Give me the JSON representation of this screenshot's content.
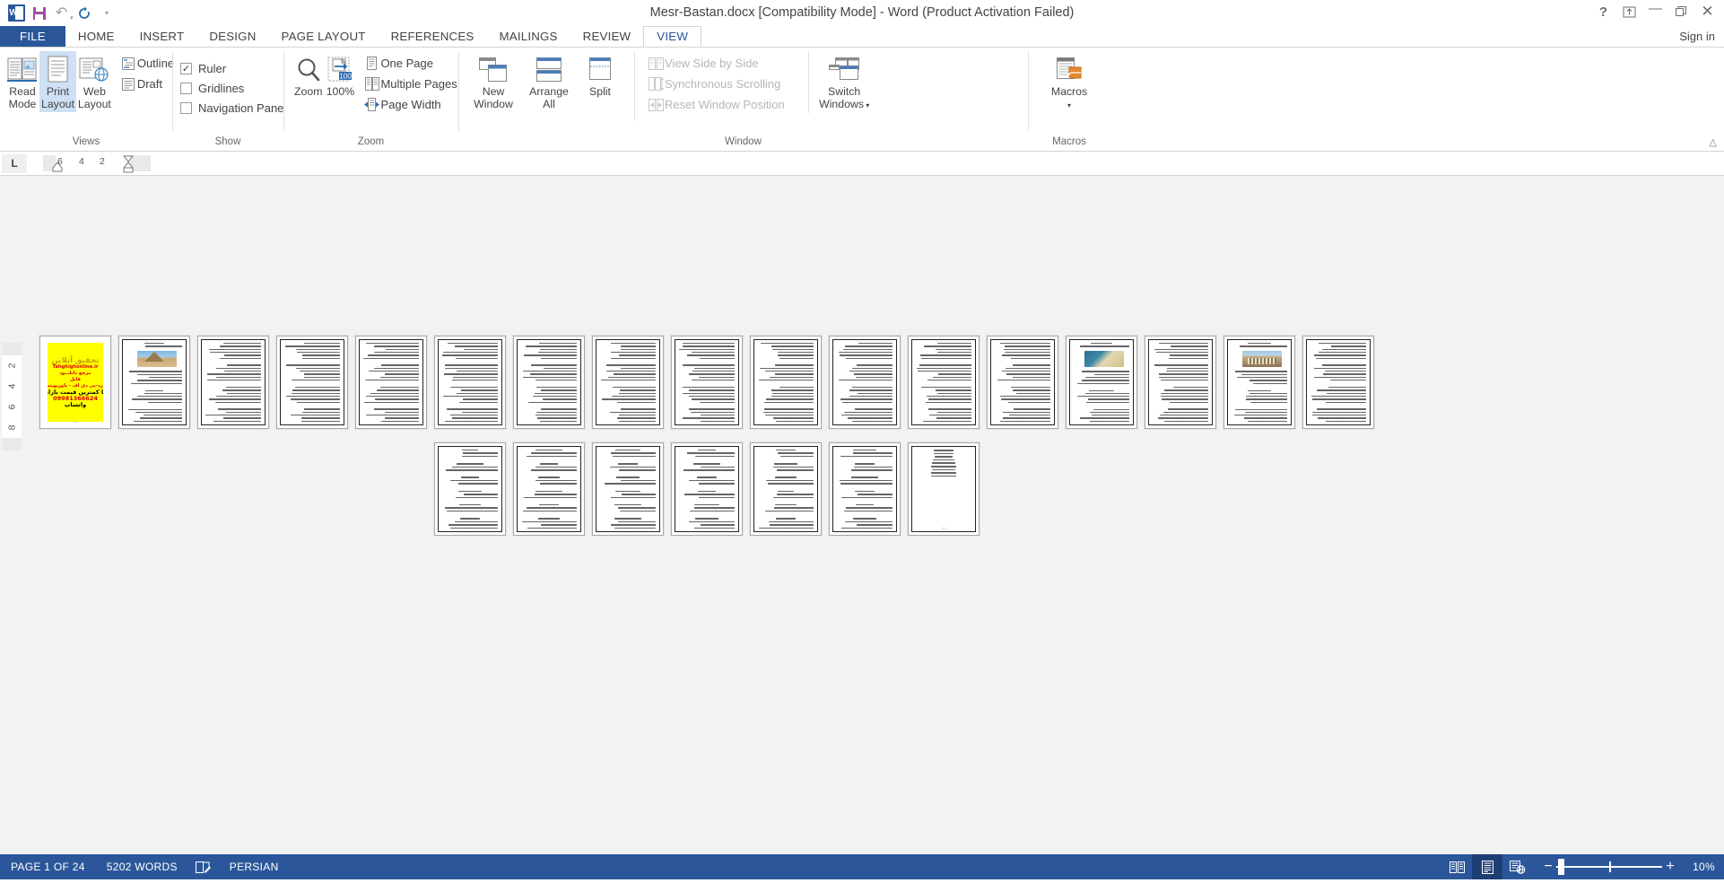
{
  "titlebar": {
    "document_title": "Mesr-Bastan.docx [Compatibility Mode] - Word (Product Activation Failed)",
    "quick_access": [
      {
        "name": "word-app-icon",
        "label": "W"
      },
      {
        "name": "save-icon",
        "label": ""
      },
      {
        "name": "undo-icon",
        "label": "↶"
      },
      {
        "name": "redo-icon",
        "label": "↻"
      },
      {
        "name": "customize-qat-icon",
        "label": "▾"
      }
    ],
    "window_controls": {
      "help": "?",
      "ribbon_display_options": "",
      "minimize": "—",
      "restore": "❐",
      "close": "✕"
    }
  },
  "tabs": [
    {
      "label": "FILE",
      "kind": "file"
    },
    {
      "label": "HOME",
      "kind": "normal"
    },
    {
      "label": "INSERT",
      "kind": "normal"
    },
    {
      "label": "DESIGN",
      "kind": "normal"
    },
    {
      "label": "PAGE LAYOUT",
      "kind": "normal"
    },
    {
      "label": "REFERENCES",
      "kind": "normal"
    },
    {
      "label": "MAILINGS",
      "kind": "normal"
    },
    {
      "label": "REVIEW",
      "kind": "normal"
    },
    {
      "label": "VIEW",
      "kind": "active"
    }
  ],
  "signin": "Sign in",
  "ribbon": {
    "collapse_arrow": "∧",
    "groups": {
      "views": {
        "label": "Views",
        "buttons": [
          {
            "name": "read-mode-button",
            "line1": "Read",
            "line2": "Mode",
            "selected": false
          },
          {
            "name": "print-layout-button",
            "line1": "Print",
            "line2": "Layout",
            "selected": true
          },
          {
            "name": "web-layout-button",
            "line1": "Web",
            "line2": "Layout",
            "selected": false
          }
        ],
        "small": [
          {
            "name": "outline-button",
            "label": "Outline"
          },
          {
            "name": "draft-button",
            "label": "Draft"
          }
        ]
      },
      "show": {
        "label": "Show",
        "checkboxes": [
          {
            "name": "ruler-checkbox",
            "label": "Ruler",
            "checked": true
          },
          {
            "name": "gridlines-checkbox",
            "label": "Gridlines",
            "checked": false
          },
          {
            "name": "navigation-pane-checkbox",
            "label": "Navigation Pane",
            "checked": false
          }
        ]
      },
      "zoom": {
        "label": "Zoom",
        "buttons": [
          {
            "name": "zoom-button",
            "label": "Zoom"
          },
          {
            "name": "zoom-100-button",
            "label": "100%",
            "badge": "100"
          }
        ],
        "small": [
          {
            "name": "one-page-button",
            "label": "One Page"
          },
          {
            "name": "multiple-pages-button",
            "label": "Multiple Pages"
          },
          {
            "name": "page-width-button",
            "label": "Page Width"
          }
        ]
      },
      "window": {
        "label": "Window",
        "buttons": [
          {
            "name": "new-window-button",
            "line1": "New",
            "line2": "Window"
          },
          {
            "name": "arrange-all-button",
            "line1": "Arrange",
            "line2": "All"
          },
          {
            "name": "split-button",
            "line1": "Split",
            "line2": ""
          }
        ],
        "small": [
          {
            "name": "view-side-by-side-button",
            "label": "View Side by Side",
            "disabled": true
          },
          {
            "name": "synchronous-scrolling-button",
            "label": "Synchronous Scrolling",
            "disabled": true
          },
          {
            "name": "reset-window-position-button",
            "label": "Reset Window Position",
            "disabled": true
          }
        ],
        "switch_windows": {
          "name": "switch-windows-button",
          "line1": "Switch",
          "line2": "Windows"
        }
      },
      "macros": {
        "label": "Macros",
        "button": {
          "name": "macros-button",
          "line1": "Macros",
          "line2": ""
        }
      }
    }
  },
  "ruler": {
    "tab_stop_indicator": "L",
    "horizontal_numbers": [
      "6",
      "4",
      "2"
    ],
    "vertical_numbers": [
      "2",
      "4",
      "6",
      "8"
    ]
  },
  "document": {
    "zoom_percent": "10%",
    "ad_page": {
      "title": "تحقیق آنلاین",
      "site": "Tahghighonline.ir",
      "line1": "مرجع دانلـــود",
      "line2": "فایل",
      "line3": "ورد-پی دی اف - پاورپوینت",
      "line4": "با کمترین قیمت بازار",
      "phone": "09981366624",
      "whatsapp": "واتساپ"
    },
    "row1_pages": [
      {
        "n": 1,
        "kind": "ad"
      },
      {
        "n": 2,
        "kind": "image",
        "image": "img-pyramid"
      },
      {
        "n": 3,
        "kind": "text"
      },
      {
        "n": 4,
        "kind": "text"
      },
      {
        "n": 5,
        "kind": "text"
      },
      {
        "n": 6,
        "kind": "text"
      },
      {
        "n": 7,
        "kind": "text"
      },
      {
        "n": 8,
        "kind": "text"
      },
      {
        "n": 9,
        "kind": "text"
      },
      {
        "n": 10,
        "kind": "text"
      },
      {
        "n": 11,
        "kind": "text"
      },
      {
        "n": 12,
        "kind": "text"
      },
      {
        "n": 13,
        "kind": "text"
      },
      {
        "n": 14,
        "kind": "image",
        "image": "img-aerial"
      },
      {
        "n": 15,
        "kind": "text"
      },
      {
        "n": 16,
        "kind": "image",
        "image": "img-temple"
      },
      {
        "n": 17,
        "kind": "text"
      }
    ],
    "row2_pages": [
      {
        "n": 18,
        "kind": "list"
      },
      {
        "n": 19,
        "kind": "list"
      },
      {
        "n": 20,
        "kind": "list"
      },
      {
        "n": 21,
        "kind": "list"
      },
      {
        "n": 22,
        "kind": "list"
      },
      {
        "n": 23,
        "kind": "list"
      },
      {
        "n": 24,
        "kind": "short"
      }
    ]
  },
  "statusbar": {
    "page_indicator": "PAGE 1 OF 24",
    "word_count": "5202 WORDS",
    "proofing_icon": "proofing-icon",
    "language": "PERSIAN",
    "view_buttons": [
      {
        "name": "read-mode-view-button",
        "active": false
      },
      {
        "name": "print-layout-view-button",
        "active": true
      },
      {
        "name": "web-layout-view-button",
        "active": false
      }
    ],
    "zoom_out": "−",
    "zoom_in": "+",
    "zoom_level": "10%"
  }
}
